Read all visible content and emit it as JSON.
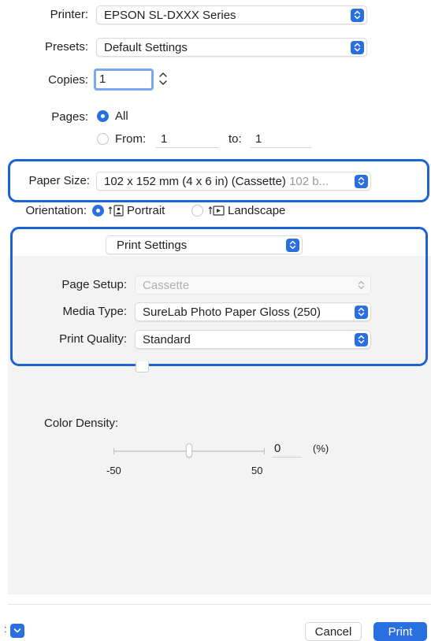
{
  "printer": {
    "label": "Printer:",
    "value": "EPSON SL-DXXX Series"
  },
  "presets": {
    "label": "Presets:",
    "value": "Default Settings"
  },
  "copies": {
    "label": "Copies:",
    "value": "1"
  },
  "pages": {
    "label": "Pages:",
    "all_label": "All",
    "from_label": "From:",
    "from_value": "1",
    "to_label": "to:",
    "to_value": "1",
    "selected": "All"
  },
  "paper_size": {
    "label": "Paper Size:",
    "value": "102 x 152 mm (4 x 6 in) (Cassette)",
    "hint": "102 b..."
  },
  "orientation": {
    "label": "Orientation:",
    "portrait_label": "Portrait",
    "landscape_label": "Landscape",
    "selected": "Portrait"
  },
  "panel": {
    "section_popup": "Print Settings",
    "page_setup": {
      "label": "Page Setup:",
      "value": "Cassette",
      "enabled": false
    },
    "media_type": {
      "label": "Media Type:",
      "value": "SureLab Photo Paper Gloss (250)"
    },
    "print_quality": {
      "label": "Print Quality:",
      "value": "Standard"
    },
    "color_density": {
      "label": "Color Density:",
      "value": "0",
      "unit": "(%)",
      "min_label": "-50",
      "max_label": "50",
      "min": -50,
      "max": 50
    }
  },
  "footer": {
    "cancel_label": "Cancel",
    "print_label": "Print"
  },
  "colors": {
    "accent": "#2a6fe0",
    "highlight_border": "#1e63d6",
    "panel_bg": "#f3f3f3"
  }
}
